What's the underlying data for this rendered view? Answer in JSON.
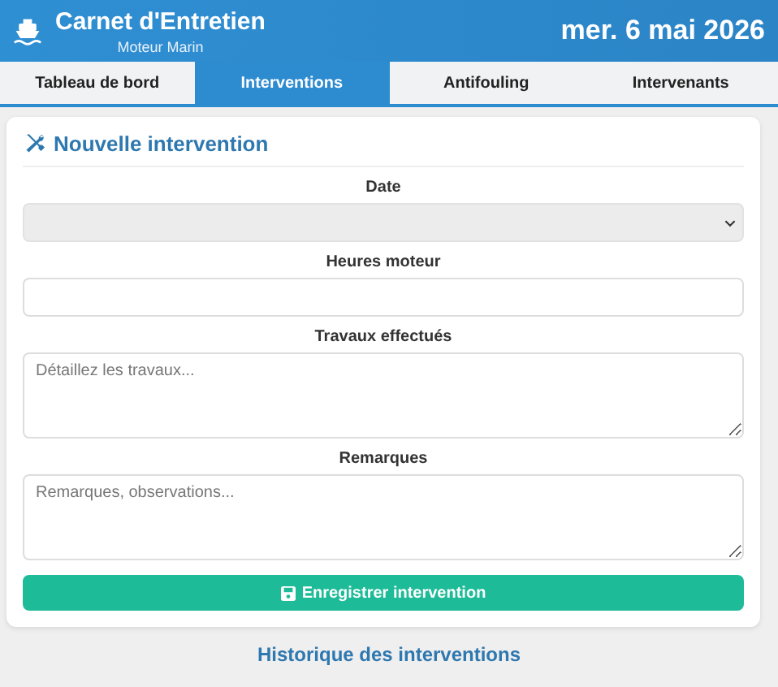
{
  "header": {
    "title": "Carnet d'Entretien",
    "subtitle": "Moteur Marin",
    "date": "mer. 6 mai 2026"
  },
  "tabs": [
    {
      "label": "Tableau de bord",
      "selected": false
    },
    {
      "label": "Interventions",
      "selected": true
    },
    {
      "label": "Antifouling",
      "selected": false
    },
    {
      "label": "Intervenants",
      "selected": false
    }
  ],
  "form": {
    "title": "Nouvelle intervention",
    "fields": [
      {
        "kind": "select",
        "label": "Date"
      },
      {
        "kind": "input",
        "label": "Heures moteur"
      },
      {
        "kind": "textarea",
        "label": "Travaux effectués",
        "placeholder": "Détaillez les travaux..."
      },
      {
        "kind": "textarea",
        "label": "Remarques",
        "placeholder": "Remarques, observations..."
      }
    ],
    "submit": "Enregistrer intervention"
  },
  "history": {
    "title": "Historique des interventions"
  }
}
